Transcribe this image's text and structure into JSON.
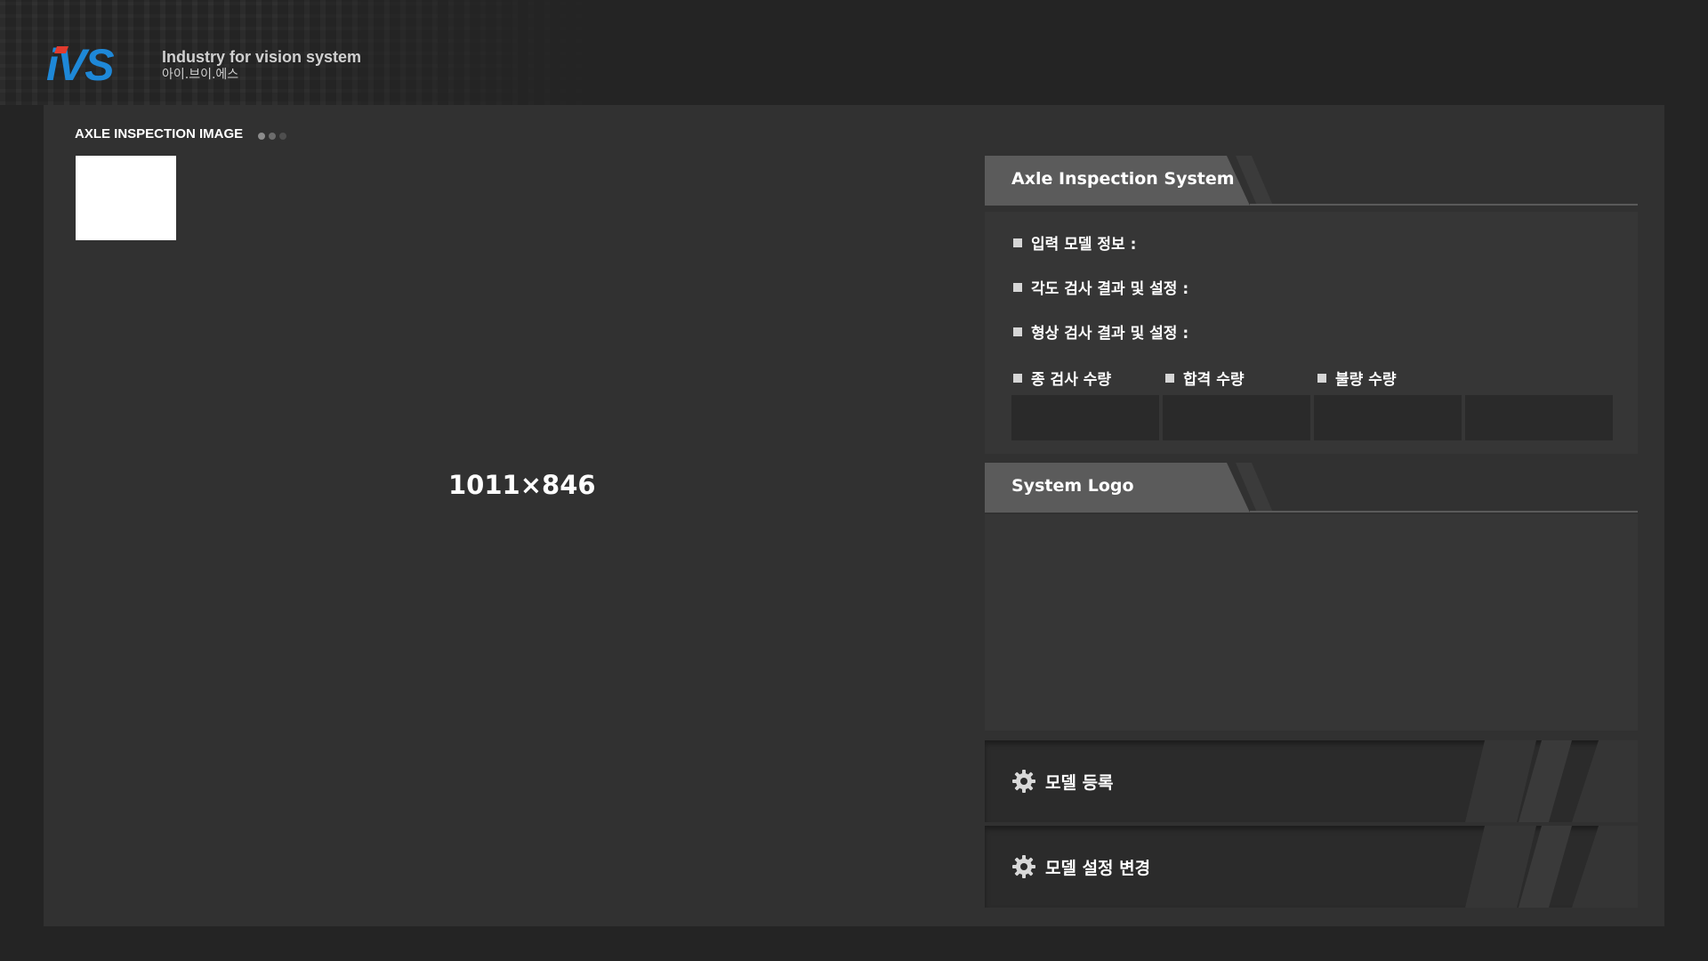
{
  "header": {
    "logo_mark": "iVS",
    "company_en": "Industry for vision system",
    "company_ko": "아이.브이.에스",
    "brand_color_blue": "#1e88d8",
    "brand_color_red": "#e33b2e"
  },
  "image_panel": {
    "title": "AXLE INSPECTION IMAGE",
    "dots": [
      "#8c8c8c",
      "#6c6c6c",
      "#4e4e4e"
    ],
    "size_label": "1011×846"
  },
  "system_panel": {
    "title": "Axle Inspection System",
    "rows": [
      "입력 모델 정보 :",
      "각도 검사 결과 및 설정 :",
      "형상 검사 결과 및 설정 :"
    ],
    "counts": {
      "total": "종 검사 수량",
      "pass": "합격 수량",
      "fail": "불량 수량"
    }
  },
  "logo_panel": {
    "title": "System Logo"
  },
  "buttons": {
    "register": "모델 등록",
    "change": "모델 설정 변경",
    "icon": "gear-icon"
  }
}
